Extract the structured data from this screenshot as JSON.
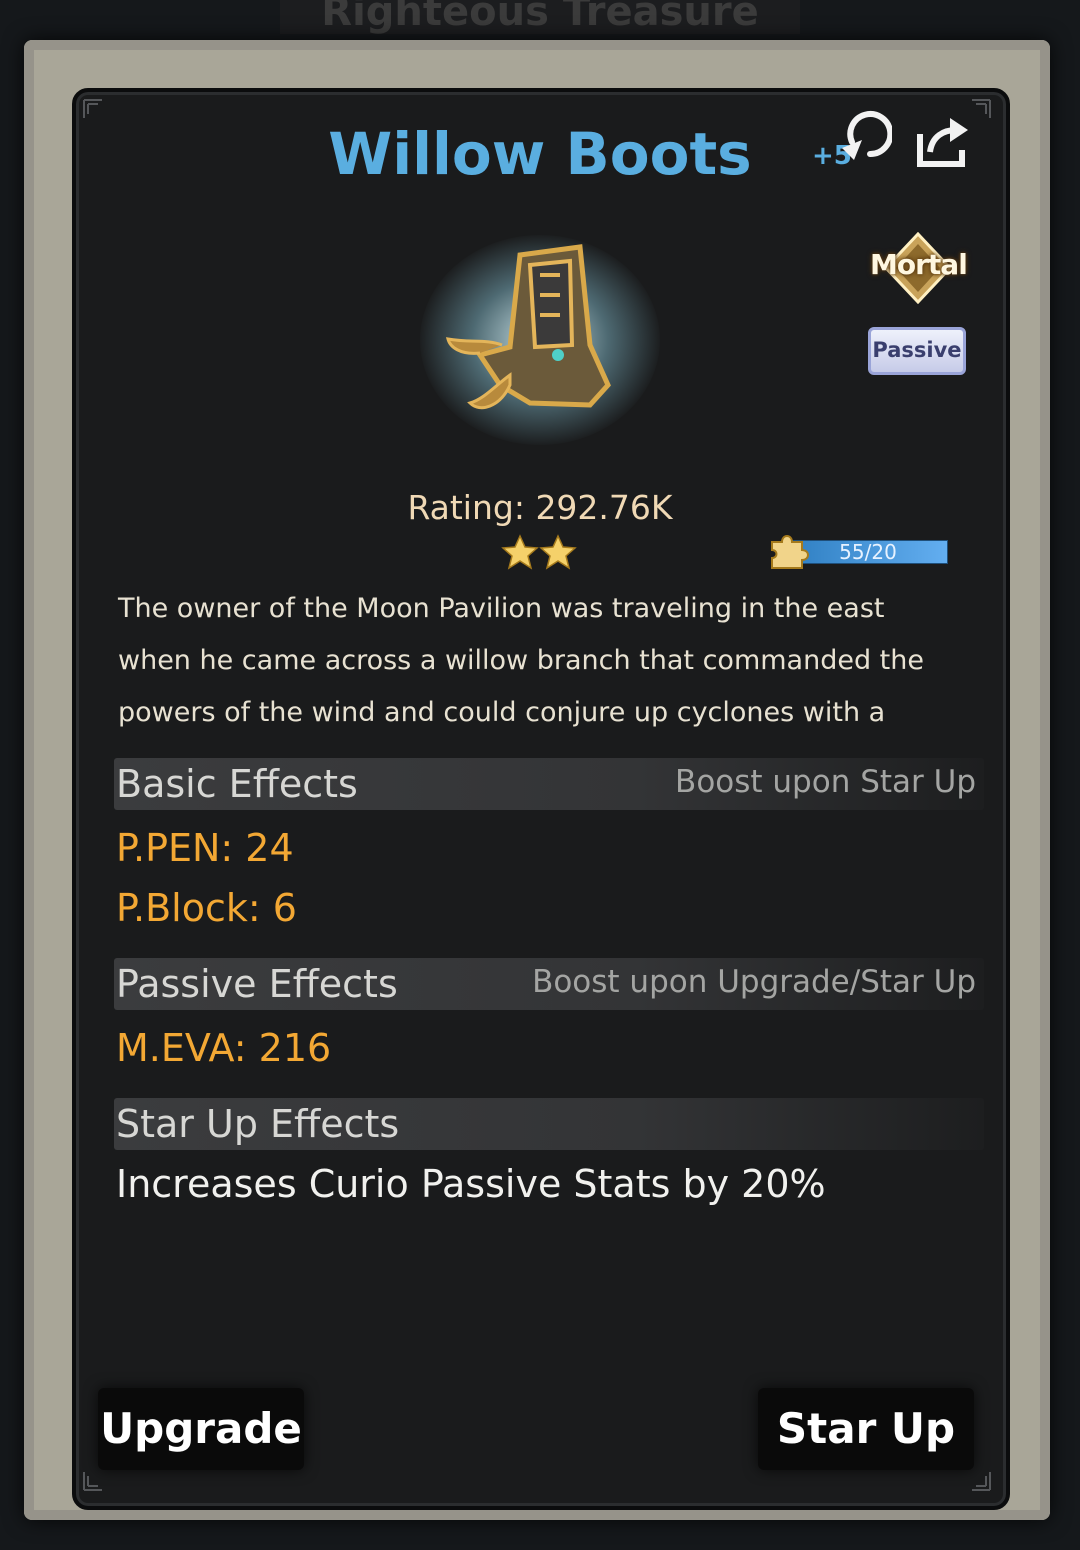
{
  "background_title": "Righteous Treasure",
  "item": {
    "name": "Willow Boots",
    "icon": "boots-icon",
    "rank": "Mortal",
    "type": "Passive",
    "rating": "Rating: 292.76K",
    "stars": 2,
    "fragments": "55/20",
    "description": [
      "The owner of the Moon Pavilion was traveling in the east",
      "when he came across a willow branch that commanded the",
      "powers of the wind and could conjure up cyclones with a"
    ]
  },
  "header_icons": {
    "reset": "reset-icon",
    "reset_label": "+5",
    "share": "share-icon"
  },
  "basic_effects": {
    "title": "Basic Effects",
    "note": "Boost upon Star Up",
    "stats": [
      "P.PEN: 24",
      "P.Block: 6"
    ]
  },
  "passive_effects": {
    "title": "Passive Effects",
    "note": "Boost upon Upgrade/Star Up",
    "stats": [
      "M.EVA: 216"
    ]
  },
  "starup_effects": {
    "title": "Star Up Effects",
    "text": "Increases Curio Passive Stats by 20%"
  },
  "buttons": {
    "upgrade": "Upgrade",
    "starup": "Star Up"
  },
  "colors": {
    "title": "#5aaee0",
    "stat": "#f3a834",
    "panel": "#1a1b1c"
  }
}
